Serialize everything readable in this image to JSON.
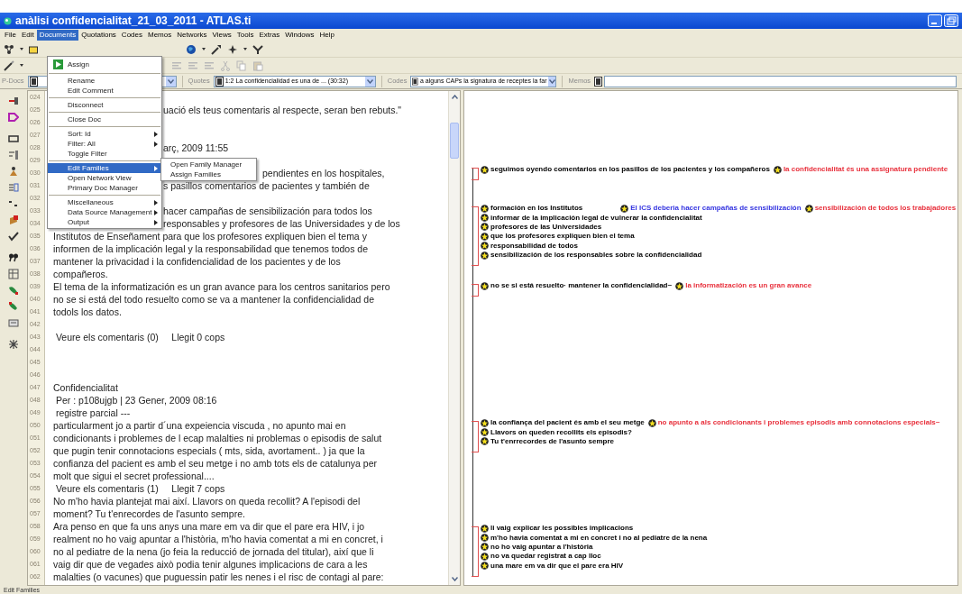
{
  "window": {
    "title": "anàlisi confidencialitat_21_03_2011 - ATLAS.ti"
  },
  "menu_bar": [
    {
      "label": "File",
      "selected": false
    },
    {
      "label": "Edit",
      "selected": false
    },
    {
      "label": "Documents",
      "selected": true
    },
    {
      "label": "Quotations",
      "selected": false
    },
    {
      "label": "Codes",
      "selected": false
    },
    {
      "label": "Memos",
      "selected": false
    },
    {
      "label": "Networks",
      "selected": false
    },
    {
      "label": "Views",
      "selected": false
    },
    {
      "label": "Tools",
      "selected": false
    },
    {
      "label": "Extras",
      "selected": false
    },
    {
      "label": "Windows",
      "selected": false
    },
    {
      "label": "Help",
      "selected": false
    }
  ],
  "documents_menu": {
    "items": [
      {
        "kind": "item",
        "label": "Assign",
        "has_icon": true,
        "submenu": false,
        "selected": false
      },
      {
        "kind": "separator"
      },
      {
        "kind": "item",
        "label": "Rename",
        "has_icon": false,
        "submenu": false,
        "selected": false
      },
      {
        "kind": "item",
        "label": "Edit Comment",
        "has_icon": false,
        "submenu": false,
        "selected": false
      },
      {
        "kind": "separator"
      },
      {
        "kind": "item",
        "label": "Disconnect",
        "has_icon": false,
        "submenu": false,
        "selected": false
      },
      {
        "kind": "separator"
      },
      {
        "kind": "item",
        "label": "Close Doc",
        "has_icon": false,
        "submenu": false,
        "selected": false
      },
      {
        "kind": "separator"
      },
      {
        "kind": "item",
        "label": "Sort: Id",
        "has_icon": false,
        "submenu": true,
        "selected": false
      },
      {
        "kind": "item",
        "label": "Filter: All",
        "has_icon": false,
        "submenu": true,
        "selected": false
      },
      {
        "kind": "item",
        "label": "Toggle Filter",
        "has_icon": false,
        "submenu": false,
        "selected": false
      },
      {
        "kind": "separator"
      },
      {
        "kind": "item",
        "label": "Edit Families",
        "has_icon": false,
        "submenu": true,
        "selected": true
      },
      {
        "kind": "item",
        "label": "Open Network View",
        "has_icon": false,
        "submenu": false,
        "selected": false
      },
      {
        "kind": "item",
        "label": "Primary Doc Manager",
        "has_icon": false,
        "submenu": false,
        "selected": false
      },
      {
        "kind": "separator"
      },
      {
        "kind": "item",
        "label": "Miscellaneous",
        "has_icon": false,
        "submenu": true,
        "selected": false
      },
      {
        "kind": "item",
        "label": "Data Source Management",
        "has_icon": false,
        "submenu": true,
        "selected": false
      },
      {
        "kind": "item",
        "label": "Output",
        "has_icon": false,
        "submenu": true,
        "selected": false
      }
    ]
  },
  "edit_families_submenu": {
    "items": [
      {
        "label": "Open Family Manager"
      },
      {
        "label": "Assign Families"
      }
    ]
  },
  "selectors": {
    "p_docs": {
      "label": "P-Docs"
    },
    "quotes": {
      "label": "Quotes",
      "value": "1:2 La confidencialidad es una de ... (30:32)"
    },
    "codes": {
      "label": "Codes",
      "value": "a alguns CAPs la signatura de receptes la far"
    },
    "memos": {
      "label": "Memos"
    }
  },
  "document": {
    "lines": [
      {
        "number": "024",
        "kind": "full"
      },
      {
        "number": "025",
        "kind": "behind_menu",
        "text": "uació els teus comentaris al respecte, seran ben rebuts.\""
      },
      {
        "number": "026",
        "kind": "full"
      },
      {
        "number": "027",
        "kind": "full"
      },
      {
        "number": "028",
        "kind": "behind_menu",
        "text": "arç, 2009 11:55"
      },
      {
        "number": "029",
        "kind": "full"
      },
      {
        "number": "030",
        "kind": "behind_submenu",
        "text": "pendientes en los hospitales,"
      },
      {
        "number": "031",
        "kind": "behind_menu",
        "text": "s pasillos comentarios de pacientes y también de"
      },
      {
        "number": "032",
        "kind": "full"
      },
      {
        "number": "033",
        "kind": "behind_menu",
        "text": "hacer campañas de sensibilización para todos los"
      },
      {
        "number": "034",
        "kind": "behind_menu",
        "text": "responsables y profesores de las Universidades y de los"
      },
      {
        "number": "035",
        "kind": "full",
        "text": "Institutos de Enseñament para que los profesores expliquen bien el tema y"
      },
      {
        "number": "036",
        "kind": "full",
        "text": "informen de la implicación legal y la responsabilidad que tenemos todos de"
      },
      {
        "number": "037",
        "kind": "full",
        "text": "mantener la privacidad i la confidencialidad de los pacientes y de los"
      },
      {
        "number": "038",
        "kind": "full",
        "text": "compañeros."
      },
      {
        "number": "039",
        "kind": "full",
        "text": "El tema de la informatización es un gran avance para los centros sanitarios pero"
      },
      {
        "number": "040",
        "kind": "full",
        "text": "no se si está del todo resuelto como se va a mantener la confidencialidad de"
      },
      {
        "number": "041",
        "kind": "full",
        "text": "todols los datos."
      },
      {
        "number": "042",
        "kind": "full"
      },
      {
        "number": "043",
        "kind": "full",
        "text": " Veure els comentaris (0)     Llegit 0 cops"
      },
      {
        "number": "044",
        "kind": "full"
      },
      {
        "number": "045",
        "kind": "full"
      },
      {
        "number": "046",
        "kind": "full"
      },
      {
        "number": "047",
        "kind": "full",
        "text": "Confidencialitat"
      },
      {
        "number": "048",
        "kind": "full",
        "text": " Per : p108ujgb | 23 Gener, 2009 08:16"
      },
      {
        "number": "049",
        "kind": "full",
        "text": " registre parcial ---"
      },
      {
        "number": "050",
        "kind": "full",
        "text": "particularment jo a partir d´una expeiencia viscuda , no apunto mai en"
      },
      {
        "number": "051",
        "kind": "full",
        "text": "condicionants i problemes de l ecap malalties ni problemas o episodis de salut"
      },
      {
        "number": "052",
        "kind": "full",
        "text": "que pugin tenir connotacions especials ( mts, sida, avortament.. ) ja que la"
      },
      {
        "number": "053",
        "kind": "full",
        "text": "confianza del pacient es amb el seu metge i no amb tots els de catalunya per"
      },
      {
        "number": "054",
        "kind": "full",
        "text": "molt que sigui el secret professional...."
      },
      {
        "number": "055",
        "kind": "full",
        "text": " Veure els comentaris (1)     Llegit 7 cops"
      },
      {
        "number": "056",
        "kind": "full",
        "text": "No m'ho havia plantejat mai així. Llavors on queda recollit? A l'episodi del"
      },
      {
        "number": "057",
        "kind": "full",
        "text": "moment? Tu t'enrecordes de l'asunto sempre."
      },
      {
        "number": "058",
        "kind": "full",
        "text": "Ara penso en que fa uns anys una mare em va dir que el pare era HIV, i jo"
      },
      {
        "number": "059",
        "kind": "full",
        "text": "realment no ho vaig apuntar a l'història, m'ho havia comentat a mi en concret, i"
      },
      {
        "number": "060",
        "kind": "full",
        "text": "no al pediatre de la nena (jo feia la reducció de jornada del titular), així que li"
      },
      {
        "number": "061",
        "kind": "full",
        "text": "vaig dir que de vegades això podia tenir algunes implicacions de cara a les"
      },
      {
        "number": "062",
        "kind": "full",
        "text": "malalties (o vacunes) que puguessin patir les nenes i el risc de contagi al pare:"
      }
    ]
  },
  "margin": {
    "groups": [
      {
        "rows": [
          [
            {
              "label": "seguimos oyendo comentarios en los pasillos de los pacientes y los compañeros",
              "color": "#000000"
            },
            {
              "label": "la confidencialitat és una assignatura pendiente",
              "color": "#e8303c"
            }
          ]
        ]
      },
      {
        "rows": [
          [
            {
              "label": "formación en los Institutos",
              "color": "#000000"
            },
            {
              "label": "El ICS deberia hacer campañas de sensibilización",
              "color": "#3434e0"
            },
            {
              "label": "sensibilización de todos los trabajadores",
              "color": "#e8303c"
            }
          ],
          [
            {
              "label": "informar de la implicación legal de vulnerar la confidencialitat",
              "color": "#000000"
            }
          ],
          [
            {
              "label": "profesores de las Universidades",
              "color": "#000000"
            }
          ],
          [
            {
              "label": "que los profesores expliquen bien el tema",
              "color": "#000000"
            }
          ],
          [
            {
              "label": "responsabilidad de todos",
              "color": "#000000"
            }
          ],
          [
            {
              "label": "sensibilización de los responsables sobre la confidencialidad",
              "color": "#000000"
            }
          ]
        ]
      },
      {
        "rows": [
          [
            {
              "label": "no se si está resuelto· mantener la confidencialidad~",
              "color": "#000000"
            },
            {
              "label": "la informatización es un gran avance",
              "color": "#e8303c"
            }
          ]
        ]
      },
      {
        "rows": [
          [
            {
              "label": "la confiança del pacient és amb el seu metge",
              "color": "#000000"
            },
            {
              "label": "no apunto a als condicionants i problemes episodis amb connotacions especials~",
              "color": "#e8303c"
            }
          ],
          [
            {
              "label": "Llavors on queden recollits els episodis?",
              "color": "#000000"
            }
          ],
          [
            {
              "label": "Tu t'enrrecordes de l'asunto sempre",
              "color": "#000000"
            }
          ]
        ]
      },
      {
        "rows": [
          [
            {
              "label": "li vaig explicar les possibles implicacions",
              "color": "#000000"
            }
          ],
          [
            {
              "label": "m'ho havia comentat a mi en concret i no al pediatre de la nena",
              "color": "#000000"
            }
          ],
          [
            {
              "label": "no ho vaig apuntar a l'història",
              "color": "#000000"
            }
          ],
          [
            {
              "label": "no va quedar registrat a cap lloc",
              "color": "#000000"
            }
          ],
          [
            {
              "label": "una mare em va dir que el pare era HIV",
              "color": "#000000"
            }
          ]
        ]
      }
    ]
  },
  "status_bar": "Edit Families"
}
